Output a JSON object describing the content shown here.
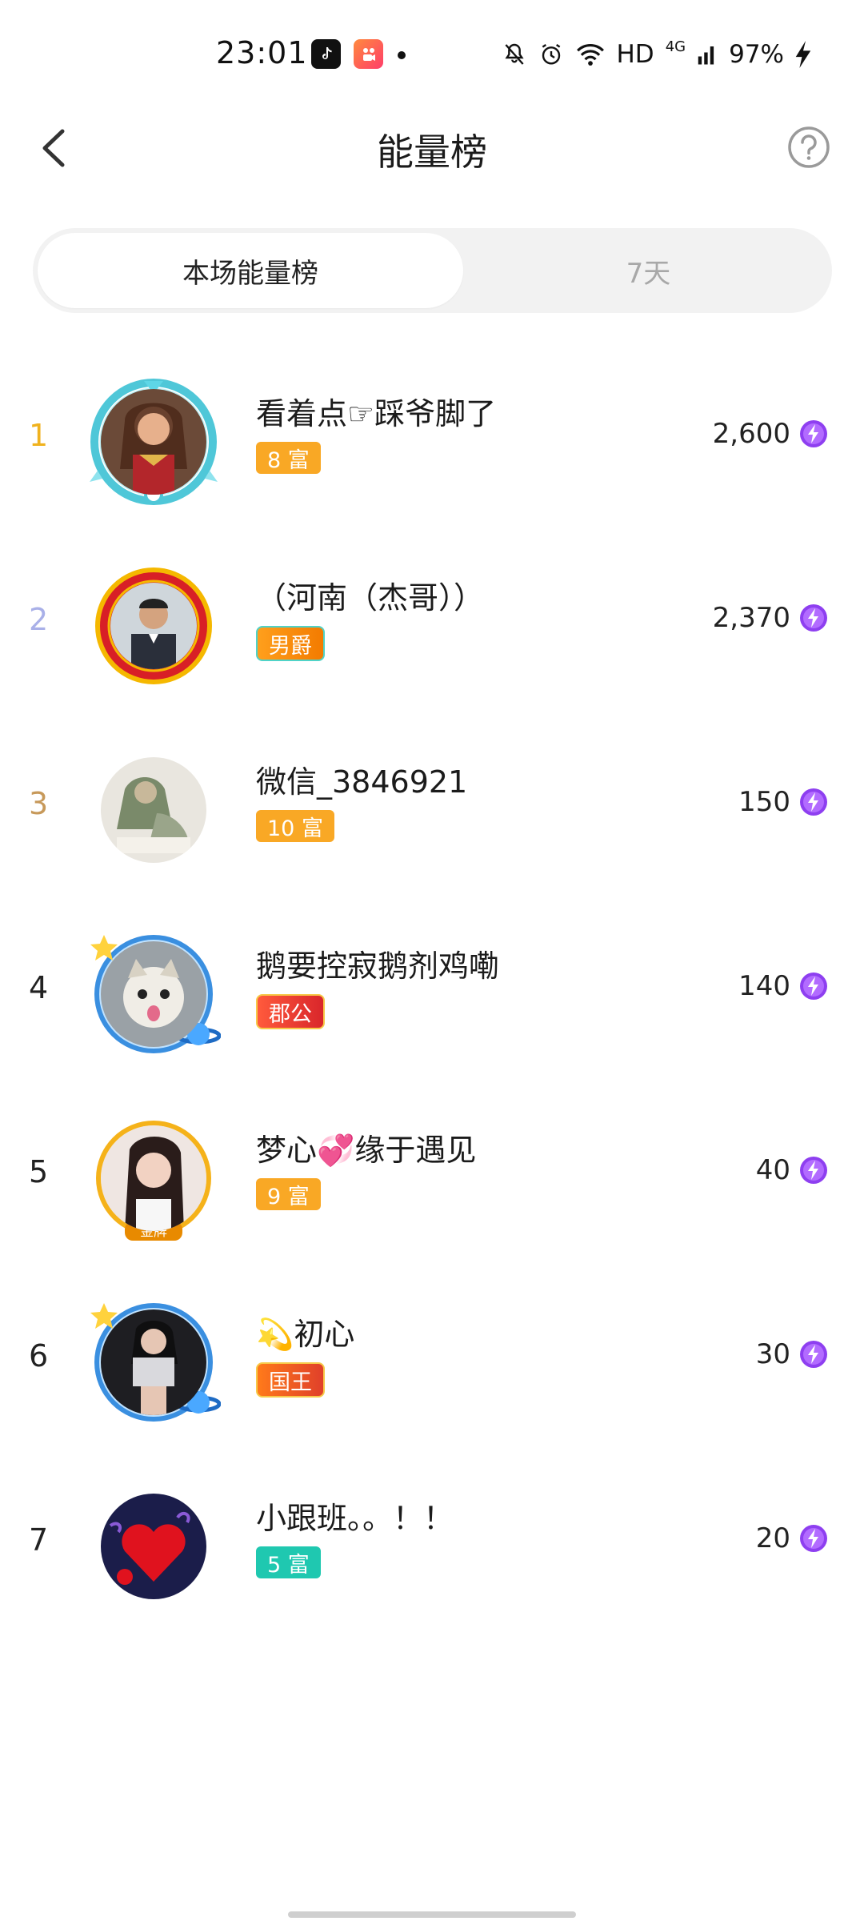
{
  "status_bar": {
    "time": "23:01",
    "network": "HD",
    "signal": "4G",
    "battery": "97%"
  },
  "header": {
    "title": "能量榜",
    "back_icon": "chevron-left-icon",
    "help_icon": "question-circle-icon"
  },
  "tabs": [
    {
      "label": "本场能量榜",
      "active": true
    },
    {
      "label": "7天",
      "active": false
    }
  ],
  "leaderboard": [
    {
      "rank": "1",
      "name": "看着点☞踩爷脚了",
      "badge": "8 富",
      "score": "2,600"
    },
    {
      "rank": "2",
      "name": "（河南（杰哥））",
      "badge": "男爵",
      "score": "2,370"
    },
    {
      "rank": "3",
      "name": "微信_3846921",
      "badge": "10 富",
      "score": "150"
    },
    {
      "rank": "4",
      "name": "鹅要控寂鹅剂鸡嘞",
      "badge": "郡公",
      "score": "140"
    },
    {
      "rank": "5",
      "name": "梦心💞缘于遇见",
      "badge": "9 富",
      "score": "40"
    },
    {
      "rank": "6",
      "name": "💫初心",
      "badge": "国王",
      "score": "30"
    },
    {
      "rank": "7",
      "name": "小跟班。。！！",
      "badge": "5 富",
      "score": "20"
    }
  ],
  "colors": {
    "rank1": "#f0b21e",
    "rank2": "#a9b0e8",
    "rank3": "#c7995a",
    "badge_orange": "#f9a825",
    "badge_teal": "#1fc8b0",
    "badge_red": "#e8453c",
    "energy_purple": "#8e3ff0"
  }
}
